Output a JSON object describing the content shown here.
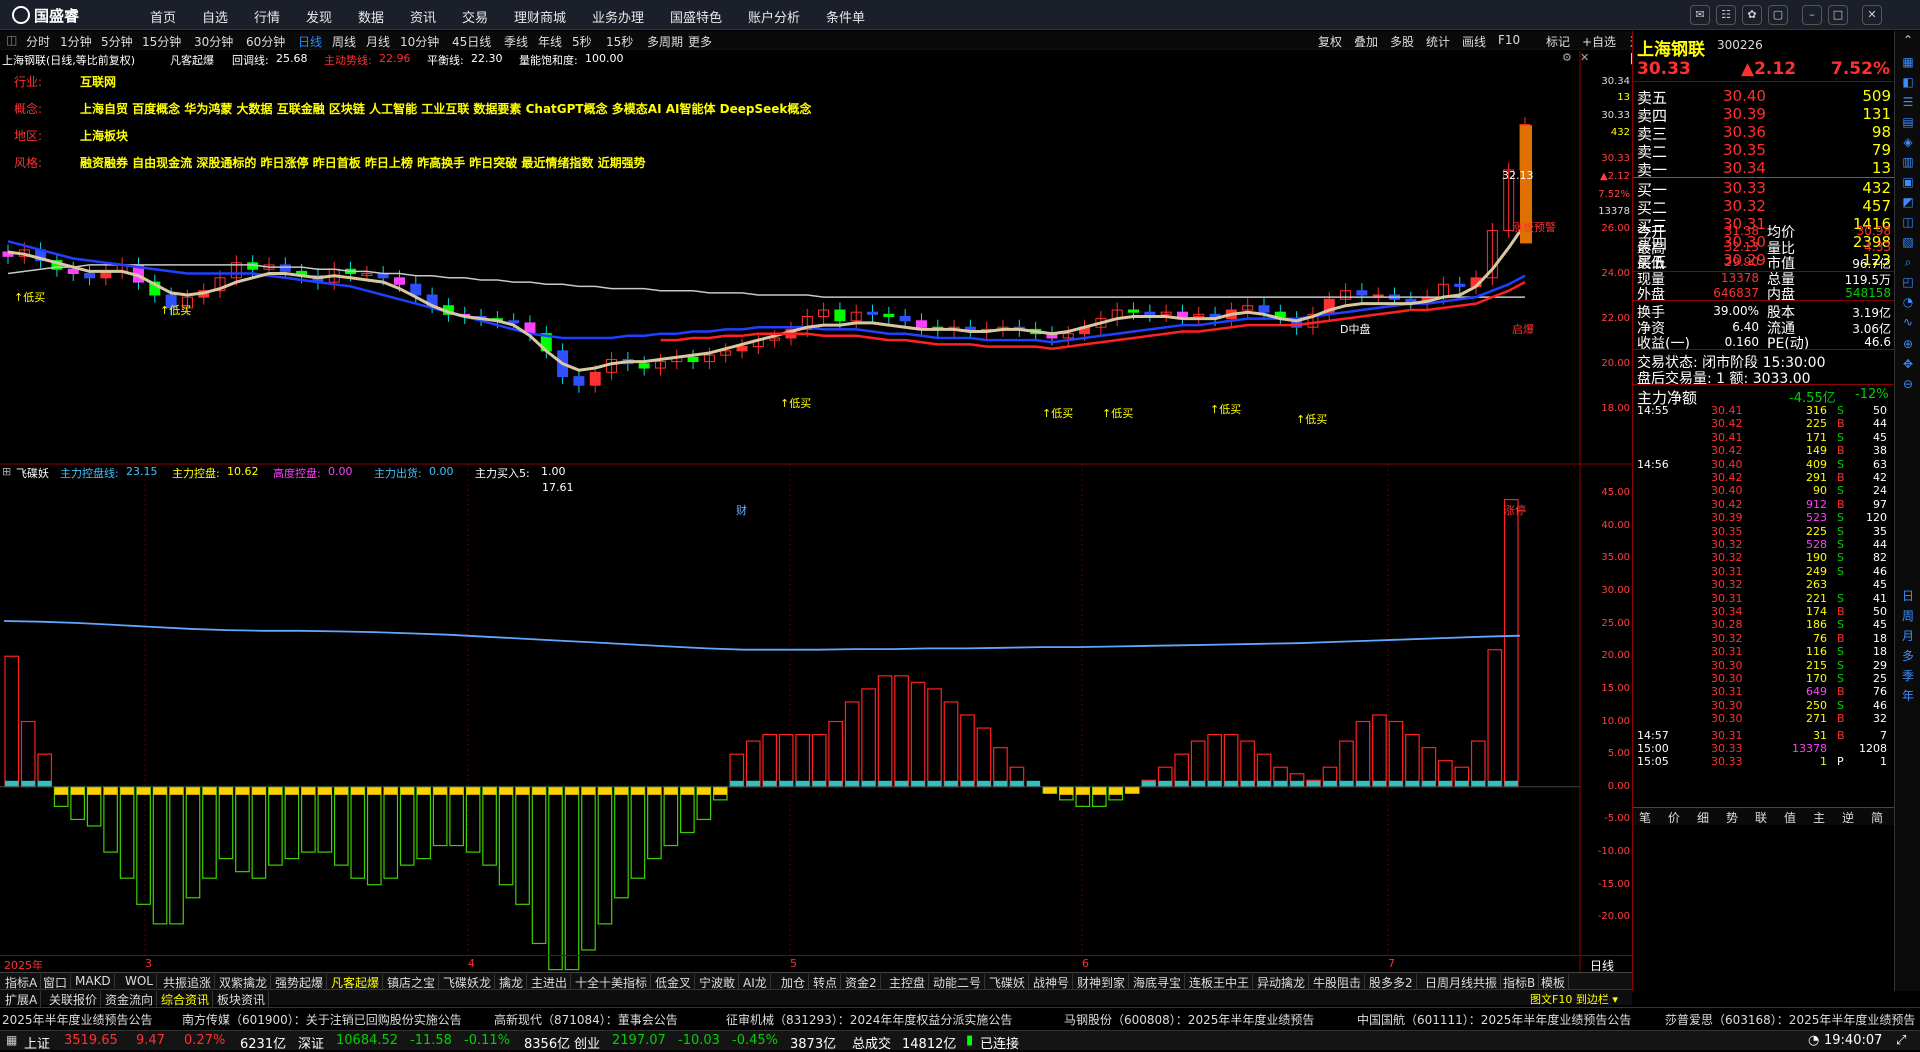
{
  "app": {
    "logo": "国盛睿"
  },
  "menu": [
    "首页",
    "自选",
    "行情",
    "发现",
    "数据",
    "资讯",
    "交易",
    "理财商城",
    "业务办理",
    "国盛特色",
    "账户分析",
    "条件单"
  ],
  "periods": [
    "分时",
    "1分钟",
    "5分钟",
    "15分钟",
    "30分钟",
    "60分钟",
    "日线",
    "周线",
    "月线",
    "10分钟",
    "45日线",
    "季线",
    "年线",
    "5秒",
    "15秒",
    "多周期",
    "更多"
  ],
  "active_period": "日线",
  "tools": [
    "复权",
    "叠加",
    "多股",
    "统计",
    "画线",
    "F10",
    "标记",
    "+自选",
    "返回"
  ],
  "chart_header": {
    "name": "上海钢联(日线,等比前复权)",
    "indicator": "凡客起爆",
    "items": [
      {
        "label": "回调线:",
        "value": "25.68",
        "color": "#ffffff"
      },
      {
        "label": "主动势线:",
        "value": "22.96",
        "color": "#ff3030"
      },
      {
        "label": "平衡线:",
        "value": "22.30",
        "color": "#ffffff"
      },
      {
        "label": "量能饱和度:",
        "value": "100.00",
        "color": "#ffffff"
      }
    ]
  },
  "annotations": [
    {
      "label": "行业:",
      "value": "互联网"
    },
    {
      "label": "概念:",
      "value": "上海自贸 百度概念 华为鸿蒙 大数据 互联金融 区块链 人工智能 工业互联 数据要素 ChatGPT概念 多模态AI AI智能体 DeepSeek概念"
    },
    {
      "label": "地区:",
      "value": "上海板块"
    },
    {
      "label": "风格:",
      "value": "融资融券 自由现金流 深股通标的 昨日涨停 昨日首板 昨日上榜 昨高换手 昨日突破 最近情绪指数 近期强势"
    }
  ],
  "price_axis": [
    {
      "v": "30.34",
      "c": "w"
    },
    {
      "v": "13",
      "c": "y"
    },
    {
      "v": "30.33",
      "c": "w"
    },
    {
      "v": "432",
      "c": "y"
    },
    {
      "v": "30.33",
      "c": "r"
    },
    {
      "v": "▲2.12",
      "c": "r"
    },
    {
      "v": "7.52%",
      "c": "r"
    },
    {
      "v": "13378",
      "c": "w"
    },
    {
      "v": "26.00",
      "c": "r"
    },
    {
      "v": "24.00",
      "c": "r"
    },
    {
      "v": "22.00",
      "c": "r"
    },
    {
      "v": "20.00",
      "c": "r"
    },
    {
      "v": "18.00",
      "c": "r"
    }
  ],
  "chart_labels": {
    "high": "32.13",
    "low": "17.61",
    "limit_up_warn": "涨板预警",
    "qibao": "启爆",
    "d_mid": "D中盘",
    "finance": "财",
    "zhangting": "涨停",
    "low_buy": "低买"
  },
  "sub_header": {
    "name": "飞碟妖",
    "items": [
      {
        "label": "主力控盘线:",
        "value": "23.15",
        "color": "#40c0ff"
      },
      {
        "label": "主力控盘:",
        "value": "10.62",
        "color": "#ffff00"
      },
      {
        "label": "高度控盘:",
        "value": "0.00",
        "color": "#ff40ff"
      },
      {
        "label": "主力出货:",
        "value": "0.00",
        "color": "#40c0ff"
      },
      {
        "label": "主力买入5:",
        "value": "1.00",
        "color": "#ffffff"
      }
    ]
  },
  "sub_axis": [
    "45.00",
    "40.00",
    "35.00",
    "30.00",
    "25.00",
    "20.00",
    "15.00",
    "10.00",
    "5.00",
    "0.00",
    "-5.00",
    "-10.00",
    "-15.00",
    "-20.00"
  ],
  "month_axis": {
    "year": "2025年",
    "months": [
      "3",
      "4",
      "5",
      "6",
      "7"
    ],
    "period": "日线"
  },
  "chart_data": [
    {
      "type": "candlestick",
      "title": "上海钢联(日线,等比前复权)",
      "ylim": [
        17.0,
        30.5
      ],
      "high_marker": 32.13,
      "low_marker": 17.61,
      "close": [
        24.2,
        24.5,
        24.0,
        23.6,
        23.4,
        23.2,
        23.5,
        23.8,
        23.0,
        22.4,
        21.8,
        22.3,
        22.6,
        23.2,
        23.9,
        23.6,
        23.8,
        23.5,
        23.3,
        23.0,
        23.6,
        23.4,
        23.4,
        23.2,
        22.9,
        22.4,
        21.9,
        21.5,
        21.4,
        21.3,
        21.2,
        21.1,
        20.6,
        19.8,
        18.6,
        18.2,
        18.8,
        19.4,
        19.2,
        19.0,
        19.3,
        19.5,
        19.3,
        19.6,
        19.8,
        20.0,
        20.3,
        20.4,
        20.8,
        21.4,
        21.7,
        21.2,
        21.6,
        21.5,
        21.4,
        21.2,
        20.9,
        20.8,
        20.9,
        20.7,
        20.8,
        20.9,
        20.8,
        20.6,
        20.4,
        20.6,
        20.9,
        21.3,
        21.7,
        21.6,
        21.5,
        21.6,
        21.4,
        21.5,
        21.3,
        21.7,
        21.9,
        21.6,
        21.3,
        20.9,
        21.5,
        22.2,
        22.6,
        22.4,
        22.4,
        22.2,
        22.0,
        22.3,
        22.9,
        22.8,
        23.2,
        25.4,
        28.22,
        30.33
      ],
      "ma_fast": [
        24.4,
        24.3,
        24.1,
        23.9,
        23.7,
        23.5,
        23.5,
        23.5,
        23.3,
        22.9,
        22.5,
        22.4,
        22.5,
        22.7,
        23.0,
        23.2,
        23.4,
        23.4,
        23.3,
        23.2,
        23.3,
        23.2,
        23.1,
        23.0,
        22.7,
        22.3,
        21.9,
        21.6,
        21.4,
        21.3,
        21.2,
        21.0,
        20.5,
        19.8,
        19.2,
        18.9,
        19.0,
        19.2,
        19.3,
        19.3,
        19.4,
        19.5,
        19.6,
        19.7,
        19.9,
        20.1,
        20.3,
        20.5,
        20.7,
        20.9,
        21.0,
        21.0,
        21.1,
        21.1,
        21.0,
        20.9,
        20.8,
        20.8,
        20.8,
        20.7,
        20.7,
        20.8,
        20.8,
        20.7,
        20.6,
        20.7,
        20.9,
        21.1,
        21.3,
        21.4,
        21.4,
        21.4,
        21.3,
        21.3,
        21.3,
        21.5,
        21.6,
        21.5,
        21.3,
        21.2,
        21.4,
        21.7,
        21.9,
        22.0,
        22.0,
        22.0,
        22.0,
        22.1,
        22.3,
        22.4,
        22.8,
        23.6,
        24.6,
        25.7
      ],
      "ma_mid": [
        24.9,
        24.7,
        24.5,
        24.3,
        24.1,
        24.0,
        23.9,
        23.8,
        23.7,
        23.6,
        23.5,
        23.4,
        23.4,
        23.4,
        23.4,
        23.4,
        23.3,
        23.2,
        23.1,
        23.0,
        22.9,
        22.8,
        22.6,
        22.4,
        22.2,
        22.0,
        21.8,
        21.6,
        21.4,
        21.2,
        21.0,
        20.8,
        20.6,
        20.5,
        20.4,
        20.4,
        20.4,
        20.4,
        20.5,
        20.5,
        20.6,
        20.6,
        20.7,
        20.7,
        20.8,
        20.8,
        20.9,
        20.9,
        20.9,
        20.9,
        20.8,
        20.8,
        20.8,
        20.7,
        20.6,
        20.6,
        20.5,
        20.4,
        20.4,
        20.4,
        20.3,
        20.3,
        20.3,
        20.3,
        20.2,
        20.3,
        20.4,
        20.5,
        20.6,
        20.7,
        20.8,
        20.9,
        21.0,
        21.0,
        21.1,
        21.2,
        21.3,
        21.3,
        21.3,
        21.3,
        21.4,
        21.5,
        21.6,
        21.7,
        21.8,
        21.9,
        22.0,
        22.0,
        22.1,
        22.2,
        22.3,
        22.6,
        22.9,
        23.3
      ],
      "ma_slow": [
        23.4,
        23.5,
        23.6,
        23.7,
        23.7,
        23.8,
        23.8,
        23.8,
        23.8,
        23.8,
        23.8,
        23.8,
        23.8,
        23.8,
        23.8,
        23.8,
        23.7,
        23.7,
        23.7,
        23.6,
        23.6,
        23.5,
        23.5,
        23.4,
        23.4,
        23.3,
        23.3,
        23.2,
        23.2,
        23.1,
        23.1,
        23.0,
        23.0,
        22.9,
        22.9,
        22.8,
        22.8,
        22.7,
        22.7,
        22.7,
        22.6,
        22.6,
        22.6,
        22.5,
        22.5,
        22.5,
        22.4,
        22.4,
        22.4,
        22.4,
        22.3,
        22.3,
        22.3,
        22.3,
        22.3,
        22.3,
        22.3,
        22.3,
        22.3,
        22.3,
        22.3,
        22.3,
        22.3,
        22.3,
        22.3,
        22.3,
        22.3,
        22.3,
        22.3,
        22.3,
        22.3,
        22.3,
        22.3,
        22.3,
        22.3,
        22.3,
        22.3,
        22.3,
        22.3,
        22.3,
        22.3,
        22.3,
        22.3,
        22.3,
        22.3,
        22.3,
        22.3,
        22.3,
        22.3,
        22.3,
        22.3,
        22.3,
        22.3,
        22.3
      ]
    },
    {
      "type": "bar",
      "title": "飞碟妖",
      "ylim": [
        -25,
        47
      ],
      "values": [
        20,
        10,
        5,
        -3,
        -5,
        -6,
        -10,
        -14,
        -18,
        -21,
        -21,
        -17,
        -14,
        -11,
        -13,
        -14,
        -12,
        -11,
        -10,
        -10,
        -12,
        -14,
        -15,
        -14,
        -12,
        -11,
        -9,
        -9,
        -10,
        -12,
        -15,
        -18,
        -24,
        -28,
        -28,
        -25,
        -21,
        -17,
        -14,
        -11,
        -9,
        -7,
        -5,
        -2,
        5,
        7,
        8,
        8,
        8,
        8,
        10,
        13,
        15,
        17,
        17,
        16,
        15,
        13,
        11,
        9,
        6,
        3,
        0,
        -1,
        -2,
        -3,
        -3,
        -2,
        -1,
        1,
        3,
        5,
        7,
        8,
        8,
        7,
        5,
        3,
        2,
        1,
        3,
        7,
        10,
        11,
        10,
        8,
        6,
        4,
        3,
        7,
        21,
        44
      ],
      "baseline_line": [
        25.4,
        25.3,
        25.1,
        24.8,
        24.5,
        24.2,
        24.0,
        23.9,
        23.9,
        23.8,
        23.7,
        23.5,
        23.3,
        23.0,
        22.7,
        22.4,
        22.1,
        21.8,
        21.5,
        21.2,
        21.0,
        21.0,
        21.0,
        21.1,
        21.1,
        21.2,
        21.2,
        21.3,
        21.4,
        21.4,
        21.5,
        21.6,
        21.7,
        21.8,
        21.9,
        22.0,
        22.2,
        22.4,
        22.6,
        22.8,
        23.0,
        23.15
      ]
    }
  ],
  "quote": {
    "name": "上海钢联",
    "code": "300226",
    "price": "30.33",
    "change": "▲2.12",
    "pct": "7.52%",
    "asks": [
      {
        "l": "卖五",
        "p": "30.40",
        "v": "509"
      },
      {
        "l": "卖四",
        "p": "30.39",
        "v": "131"
      },
      {
        "l": "卖三",
        "p": "30.36",
        "v": "98"
      },
      {
        "l": "卖二",
        "p": "30.35",
        "v": "79"
      },
      {
        "l": "卖一",
        "p": "30.34",
        "v": "13"
      }
    ],
    "bids": [
      {
        "l": "买一",
        "p": "30.33",
        "v": "432"
      },
      {
        "l": "买二",
        "p": "30.32",
        "v": "457"
      },
      {
        "l": "买三",
        "p": "30.31",
        "v": "1416"
      },
      {
        "l": "买四",
        "p": "30.30",
        "v": "2398"
      },
      {
        "l": "买五",
        "p": "30.29",
        "v": "123"
      }
    ],
    "stats": [
      {
        "a": "今开",
        "av": "31.38",
        "ac": "red",
        "b": "均价",
        "bv": "30.98",
        "bc": "red"
      },
      {
        "a": "最高",
        "av": "32.13",
        "ac": "red",
        "b": "量比",
        "bv": "4.33",
        "bc": "red"
      },
      {
        "a": "最低",
        "av": "29.90",
        "ac": "red",
        "b": "市值",
        "bv": "96.7亿",
        "bc": "white"
      },
      {
        "a": "现量",
        "av": "13378",
        "ac": "red",
        "b": "总量",
        "bv": "119.5万",
        "bc": "white"
      },
      {
        "a": "外盘",
        "av": "646837",
        "ac": "red",
        "b": "内盘",
        "bv": "548158",
        "bc": "green"
      }
    ],
    "stats2": [
      {
        "a": "换手",
        "av": "39.00%",
        "b": "股本",
        "bv": "3.19亿"
      },
      {
        "a": "净资",
        "av": "6.40",
        "b": "流通",
        "bv": "3.06亿"
      },
      {
        "a": "收益(一)",
        "av": "0.160",
        "b": "PE(动)",
        "bv": "46.6"
      }
    ],
    "trade_state": "交易状态: 闭市阶段 15:30:00",
    "after_hours": "盘后交易量: 1  额: 3033.00",
    "net_label": "主力净额",
    "net_value": "-4.55亿",
    "net_pct": "-12%"
  },
  "ticks": [
    {
      "t": "14:55",
      "p": "30.41",
      "v": "316",
      "s": "S",
      "n": "50"
    },
    {
      "t": "",
      "p": "30.42",
      "v": "225",
      "s": "B",
      "n": "44"
    },
    {
      "t": "",
      "p": "30.41",
      "v": "171",
      "s": "S",
      "n": "45"
    },
    {
      "t": "",
      "p": "30.42",
      "v": "149",
      "s": "B",
      "n": "38"
    },
    {
      "t": "14:56",
      "p": "30.40",
      "v": "409",
      "s": "S",
      "n": "63"
    },
    {
      "t": "",
      "p": "30.42",
      "v": "291",
      "s": "B",
      "n": "42"
    },
    {
      "t": "",
      "p": "30.40",
      "v": "90",
      "s": "S",
      "n": "24"
    },
    {
      "t": "",
      "p": "30.42",
      "v": "912",
      "s": "B",
      "n": "97"
    },
    {
      "t": "",
      "p": "30.39",
      "v": "523",
      "s": "S",
      "n": "120"
    },
    {
      "t": "",
      "p": "30.35",
      "v": "225",
      "s": "S",
      "n": "35"
    },
    {
      "t": "",
      "p": "30.32",
      "v": "528",
      "s": "S",
      "n": "44"
    },
    {
      "t": "",
      "p": "30.32",
      "v": "190",
      "s": "S",
      "n": "82"
    },
    {
      "t": "",
      "p": "30.31",
      "v": "249",
      "s": "S",
      "n": "46"
    },
    {
      "t": "",
      "p": "30.32",
      "v": "263",
      "s": "",
      "n": "45"
    },
    {
      "t": "",
      "p": "30.31",
      "v": "221",
      "s": "S",
      "n": "41"
    },
    {
      "t": "",
      "p": "30.34",
      "v": "174",
      "s": "B",
      "n": "50"
    },
    {
      "t": "",
      "p": "30.28",
      "v": "186",
      "s": "S",
      "n": "45"
    },
    {
      "t": "",
      "p": "30.32",
      "v": "76",
      "s": "B",
      "n": "18"
    },
    {
      "t": "",
      "p": "30.31",
      "v": "116",
      "s": "S",
      "n": "18"
    },
    {
      "t": "",
      "p": "30.30",
      "v": "215",
      "s": "S",
      "n": "29"
    },
    {
      "t": "",
      "p": "30.30",
      "v": "170",
      "s": "S",
      "n": "25"
    },
    {
      "t": "",
      "p": "30.31",
      "v": "649",
      "s": "B",
      "n": "76"
    },
    {
      "t": "",
      "p": "30.30",
      "v": "250",
      "s": "S",
      "n": "46"
    },
    {
      "t": "",
      "p": "30.30",
      "v": "271",
      "s": "B",
      "n": "32"
    },
    {
      "t": "14:57",
      "p": "30.31",
      "v": "31",
      "s": "B",
      "n": "7"
    },
    {
      "t": "15:00",
      "p": "30.33",
      "v": "13378",
      "s": "",
      "n": "1208"
    },
    {
      "t": "15:05",
      "p": "30.33",
      "v": "1",
      "s": "P",
      "n": "1"
    }
  ],
  "side_tabs": [
    "日",
    "周",
    "月",
    "多",
    "季",
    "年"
  ],
  "rp_tabs": [
    "笔",
    "价",
    "细",
    "势",
    "联",
    "值",
    "主",
    "逆",
    "简"
  ],
  "bottom_tabs": [
    "指标A",
    "窗口",
    "MAKD",
    "WOL",
    "共振追涨",
    "双紫擒龙",
    "强势起爆",
    "凡客起爆",
    "镇店之宝",
    "飞碟妖龙",
    "擒龙",
    "主进出",
    "十全十美指标",
    "低金叉",
    "宁波敢",
    "AI龙",
    "加仓",
    "转点",
    "资金2",
    "主控盘",
    "动能二号",
    "飞碟妖",
    "战神号",
    "财神到家",
    "海底寻宝",
    "连板王中王",
    "异动擒龙",
    "牛股阻击",
    "股多多2",
    "日周月线共振",
    "指标B",
    "模板"
  ],
  "bottom_tabs2": [
    "扩展A",
    "关联报价",
    "资金流向",
    "综合资讯",
    "板块资讯"
  ],
  "f10_link": "图文F10 到边栏 ▾",
  "news": [
    "2025年半年度业绩预告公告",
    "南方传媒（601900）：关于注销已回购股份实施公告",
    "高新现代（871084）：董事会公告",
    "征审机械（831293）：2024年年度权益分派实施公告",
    "马钢股份（600808）：2025年半年度业绩预告",
    "中国国航（601111）：2025年半年度业绩预告公告",
    "莎普爱思（603168）：2025年半年度业绩预告公告"
  ],
  "status": {
    "sh": "上证",
    "sh_v": "3519.65",
    "sh_c": "9.47",
    "sh_p": "0.27%",
    "sh_a": "6231亿",
    "sz": "深证",
    "sz_v": "10684.52",
    "sz_c": "-11.58",
    "sz_p": "-0.11%",
    "sz_a": "8356亿",
    "cy": "创业",
    "cy_v": "2197.07",
    "cy_c": "-10.03",
    "cy_p": "-0.45%",
    "cy_a": "3873亿",
    "total": "总成交",
    "total_v": "14812亿",
    "conn": "已连接",
    "time": "19:40:07"
  }
}
